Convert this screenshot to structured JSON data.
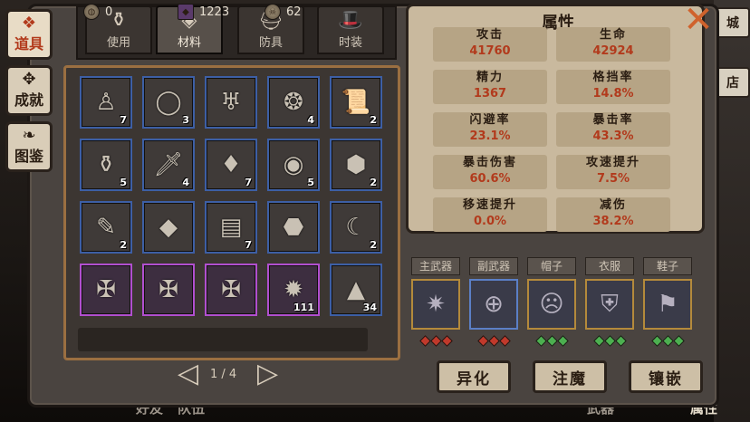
{
  "side_tabs": [
    {
      "label": "道具",
      "icon": "bag-icon",
      "active": true
    },
    {
      "label": "成就",
      "icon": "trophy-icon",
      "active": false
    },
    {
      "label": "图鉴",
      "icon": "book-icon",
      "active": false
    }
  ],
  "category_tabs": [
    {
      "label": "使用",
      "glyph": "⚱",
      "active": false
    },
    {
      "label": "材料",
      "glyph": "◈",
      "active": true
    },
    {
      "label": "防具",
      "glyph": "⛑",
      "active": false
    },
    {
      "label": "时装",
      "glyph": "🎩",
      "active": false
    }
  ],
  "inventory": {
    "rows": [
      [
        {
          "icon": "statue-icon",
          "glyph": "♙",
          "count": "7",
          "rarity": "blue"
        },
        {
          "icon": "ring-icon",
          "glyph": "◯",
          "count": "3",
          "rarity": "blue"
        },
        {
          "icon": "totem-icon",
          "glyph": "♅",
          "count": "",
          "rarity": "blue"
        },
        {
          "icon": "gold-coin-icon",
          "glyph": "❂",
          "count": "4",
          "rarity": "blue"
        },
        {
          "icon": "scroll-icon",
          "glyph": "📜",
          "count": "2",
          "rarity": "blue"
        }
      ],
      [
        {
          "icon": "jar-icon",
          "glyph": "⚱",
          "count": "5",
          "rarity": "blue"
        },
        {
          "icon": "dagger-icon",
          "glyph": "🗡",
          "count": "4",
          "rarity": "blue"
        },
        {
          "icon": "red-crystal-icon",
          "glyph": "♦",
          "count": "7",
          "rarity": "blue"
        },
        {
          "icon": "eye-icon",
          "glyph": "◉",
          "count": "5",
          "rarity": "blue"
        },
        {
          "icon": "ore-icon",
          "glyph": "⬢",
          "count": "2",
          "rarity": "blue"
        }
      ],
      [
        {
          "icon": "feather-icon",
          "glyph": "✎",
          "count": "2",
          "rarity": "blue"
        },
        {
          "icon": "blue-gem-icon",
          "glyph": "◆",
          "count": "",
          "rarity": "blue"
        },
        {
          "icon": "map-icon",
          "glyph": "▤",
          "count": "7",
          "rarity": "blue"
        },
        {
          "icon": "lava-rock-icon",
          "glyph": "⬣",
          "count": "",
          "rarity": "blue"
        },
        {
          "icon": "horn-icon",
          "glyph": "☾",
          "count": "2",
          "rarity": "blue"
        }
      ],
      [
        {
          "icon": "sealed-book-icon",
          "glyph": "✠",
          "count": "",
          "rarity": "purple"
        },
        {
          "icon": "sealed-box-icon",
          "glyph": "✠",
          "count": "",
          "rarity": "purple"
        },
        {
          "icon": "sealed-box-icon",
          "glyph": "✠",
          "count": "",
          "rarity": "purple"
        },
        {
          "icon": "glowing-stone-icon",
          "glyph": "✹",
          "count": "111",
          "rarity": "purple"
        },
        {
          "icon": "dark-shard-icon",
          "glyph": "▲",
          "count": "34",
          "rarity": "blue"
        }
      ]
    ]
  },
  "currency": [
    {
      "icon": "coin-icon",
      "value": "0"
    },
    {
      "icon": "crystal-icon",
      "value": "1223"
    },
    {
      "icon": "skull-coin-icon",
      "value": "62"
    }
  ],
  "pager": {
    "text": "1 / 4",
    "prev": "◁",
    "next": "▷"
  },
  "attributes": {
    "title": "属性",
    "stats": [
      {
        "label": "攻击",
        "value": "41760"
      },
      {
        "label": "生命",
        "value": "42924"
      },
      {
        "label": "精力",
        "value": "1367"
      },
      {
        "label": "格挡率",
        "value": "14.8%"
      },
      {
        "label": "闪避率",
        "value": "23.1%"
      },
      {
        "label": "暴击率",
        "value": "43.3%"
      },
      {
        "label": "暴击伤害",
        "value": "60.6%"
      },
      {
        "label": "攻速提升",
        "value": "7.5%"
      },
      {
        "label": "移速提升",
        "value": "0.0%"
      },
      {
        "label": "减伤",
        "value": "38.2%"
      }
    ]
  },
  "equipment": [
    {
      "label": "主武器",
      "icon": "spiked-wheel-icon",
      "glyph": "✷",
      "frame": "gold",
      "dot_color": "#c0392b"
    },
    {
      "label": "副武器",
      "icon": "compass-icon",
      "glyph": "⊕",
      "frame": "blue",
      "dot_color": "#c0392b"
    },
    {
      "label": "帽子",
      "icon": "mask-icon",
      "glyph": "☹",
      "frame": "gold",
      "dot_color": "#4caf50"
    },
    {
      "label": "衣服",
      "icon": "armor-icon",
      "glyph": "⛨",
      "frame": "gold",
      "dot_color": "#4caf50"
    },
    {
      "label": "鞋子",
      "icon": "boots-icon",
      "glyph": "⚑",
      "frame": "gold",
      "dot_color": "#4caf50"
    }
  ],
  "actions": [
    {
      "label": "异化"
    },
    {
      "label": "注魔"
    },
    {
      "label": "镶嵌"
    }
  ],
  "close": {
    "glyph": "✕"
  },
  "right_strip": [
    {
      "label": "城"
    },
    {
      "label": "店"
    }
  ],
  "scene_text": [
    {
      "text": "好友"
    },
    {
      "text": "队伍"
    },
    {
      "text": "武器"
    },
    {
      "text": "属性"
    }
  ]
}
